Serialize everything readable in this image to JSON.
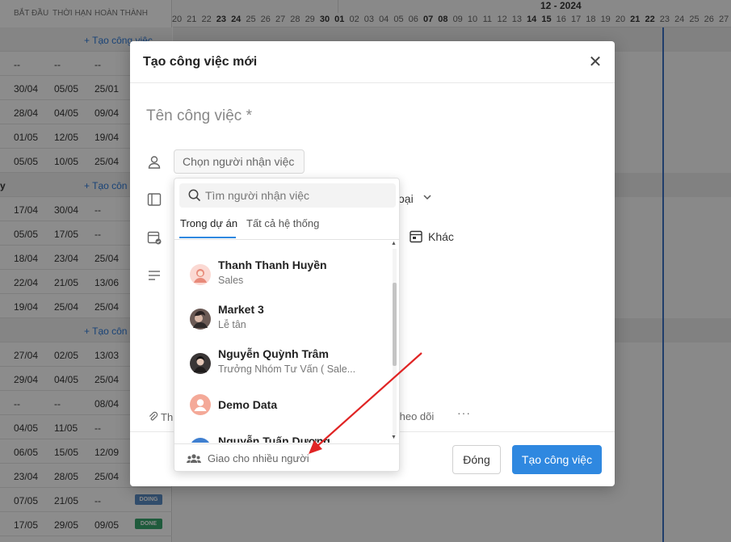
{
  "table": {
    "headers": [
      "BẮT ĐẦU",
      "THỜI HẠN",
      "HOÀN THÀNH"
    ],
    "rows": [
      {
        "type": "add",
        "label": "+ Tạo công việc"
      },
      {
        "type": "data",
        "start": "--",
        "due": "--",
        "done": "--"
      },
      {
        "type": "data",
        "start": "30/04",
        "due": "05/05",
        "done": "25/01"
      },
      {
        "type": "data",
        "start": "28/04",
        "due": "04/05",
        "done": "09/04"
      },
      {
        "type": "data",
        "start": "01/05",
        "due": "12/05",
        "done": "19/04"
      },
      {
        "type": "data",
        "start": "05/05",
        "due": "10/05",
        "done": "25/04"
      },
      {
        "type": "add",
        "group": "y",
        "label": "+ Tạo côn"
      },
      {
        "type": "data",
        "start": "17/04",
        "due": "30/04",
        "done": "--"
      },
      {
        "type": "data",
        "start": "05/05",
        "due": "17/05",
        "done": "--"
      },
      {
        "type": "data",
        "start": "18/04",
        "due": "23/04",
        "done": "25/04"
      },
      {
        "type": "data",
        "start": "22/04",
        "due": "21/05",
        "done": "13/06"
      },
      {
        "type": "data",
        "start": "19/04",
        "due": "25/04",
        "done": "25/04"
      },
      {
        "type": "add",
        "label": "+ Tạo côn"
      },
      {
        "type": "data",
        "start": "27/04",
        "due": "02/05",
        "done": "13/03"
      },
      {
        "type": "data",
        "start": "29/04",
        "due": "04/05",
        "done": "25/04"
      },
      {
        "type": "data",
        "start": "--",
        "due": "--",
        "done": "08/04"
      },
      {
        "type": "data",
        "start": "04/05",
        "due": "11/05",
        "done": "--"
      },
      {
        "type": "data",
        "start": "06/05",
        "due": "15/05",
        "done": "12/09"
      },
      {
        "type": "data",
        "start": "23/04",
        "due": "28/05",
        "done": "25/04"
      },
      {
        "type": "data",
        "start": "07/05",
        "due": "21/05",
        "done": "--",
        "badge": "DOING"
      },
      {
        "type": "data",
        "start": "17/05",
        "due": "29/05",
        "done": "09/05",
        "badge": "DONE"
      }
    ]
  },
  "timeline": {
    "month_label": "12 - 2024",
    "days": [
      "20",
      "21",
      "22",
      "23",
      "24",
      "25",
      "26",
      "27",
      "28",
      "29",
      "30",
      "01",
      "02",
      "03",
      "04",
      "05",
      "06",
      "07",
      "08",
      "09",
      "10",
      "11",
      "12",
      "13",
      "14",
      "15",
      "16",
      "17",
      "18",
      "19",
      "20",
      "21",
      "22",
      "23",
      "24",
      "25",
      "26",
      "27"
    ],
    "weekend_indices": [
      3,
      4,
      10,
      11,
      17,
      18,
      24,
      25,
      31,
      32
    ]
  },
  "modal": {
    "title": "Tạo công việc mới",
    "close_glyph": "✕",
    "task_name_placeholder": "Tên công việc *",
    "assignee_placeholder": "Chọn người nhận việc",
    "type_label_fragment": "oại",
    "other_label": "Khác",
    "attach_fragment": "Th",
    "follow_fragment": "theo dõi",
    "more_glyph": "···",
    "close_button": "Đóng",
    "create_button": "Tạo công việc"
  },
  "dropdown": {
    "search_placeholder": "Tìm người nhận việc",
    "tabs": [
      "Trong dự án",
      "Tất cả hệ thống"
    ],
    "items": [
      {
        "name": "Thanh Thanh Huyền",
        "role": "Sales"
      },
      {
        "name": "Market 3",
        "role": "Lễ tân"
      },
      {
        "name": "Nguyễn Quỳnh Trâm",
        "role": "Trưởng Nhóm Tư Vấn ( Sale..."
      },
      {
        "name": "Demo Data",
        "role": ""
      },
      {
        "name": "Nguyễn Tuấn Dương",
        "role": ""
      }
    ],
    "footer_label": "Giao cho nhiều người"
  },
  "colors": {
    "accent": "#2f88e0",
    "today_line": "#3b6fc4",
    "arrow": "#e02424",
    "badge_doing": "#5b8fc7",
    "badge_done": "#3aa76d"
  }
}
